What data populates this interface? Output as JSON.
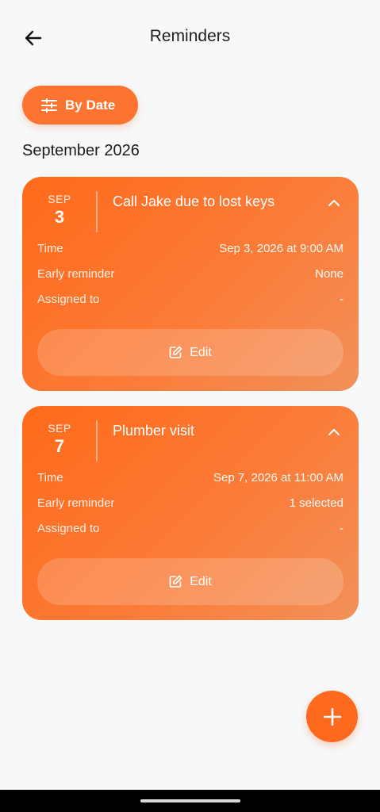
{
  "header": {
    "title": "Reminders"
  },
  "filter": {
    "label": "By Date"
  },
  "section": {
    "month": "September 2026"
  },
  "reminders": [
    {
      "month": "SEP",
      "day": "3",
      "title": "Call Jake due to lost keys",
      "time_label": "Time",
      "time_value": "Sep 3, 2026 at 9:00 AM",
      "early_label": "Early reminder",
      "early_value": "None",
      "assigned_label": "Assigned to",
      "assigned_value": "-",
      "edit_label": "Edit"
    },
    {
      "month": "SEP",
      "day": "7",
      "title": "Plumber visit",
      "time_label": "Time",
      "time_value": "Sep 7, 2026 at 11:00 AM",
      "early_label": "Early reminder",
      "early_value": "1 selected",
      "assigned_label": "Assigned to",
      "assigned_value": "-",
      "edit_label": "Edit"
    }
  ],
  "icons": {
    "back": "arrow-left-icon",
    "filter": "sliders-icon",
    "collapse": "chevron-up-icon",
    "edit": "pencil-square-icon",
    "add": "plus-icon"
  },
  "colors": {
    "accent": "#fd7430",
    "background": "#f7f8fa"
  }
}
